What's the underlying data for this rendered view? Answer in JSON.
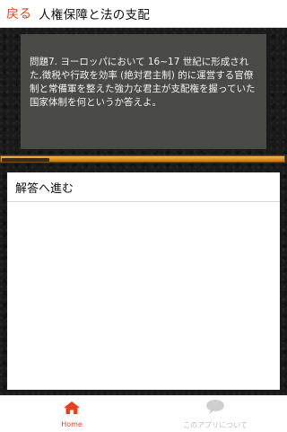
{
  "header": {
    "back_label": "戻る",
    "title": "人権保障と法の支配"
  },
  "question": {
    "text": "問題7. ヨーロッパにおいて 16~17 世紀に形成された,徴税や行政を効率 (絶対君主制) 的に運営する官僚制と常備軍を整えた強力な君主が支配権を握っていた国家体制を何というか答えよ。"
  },
  "progress": {
    "fraction": 0.17
  },
  "answer": {
    "button_label": "解答へ進む"
  },
  "bottom_nav": {
    "items": [
      {
        "label": "Home",
        "icon": "home-icon",
        "active": true
      },
      {
        "label": "このアプリについて",
        "icon": "chat-bubble-icon",
        "active": false
      }
    ]
  },
  "colors": {
    "accent": "#e8411e",
    "question_bg": "#4a4a46",
    "progress": "#e39a2a",
    "inactive": "#bdbdbd"
  }
}
